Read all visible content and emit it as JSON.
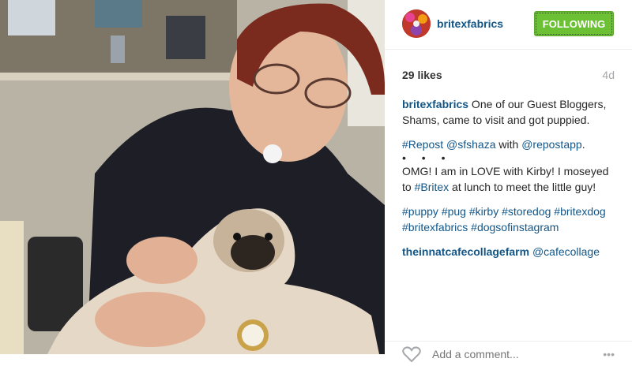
{
  "post": {
    "username": "britexfabrics",
    "follow_label": "FOLLOWING",
    "likes": "29 likes",
    "age": "4d",
    "caption": {
      "author": "britexfabrics",
      "line1": " One of our Guest Bloggers, Shams, came to visit and got puppied.",
      "repost_tag": "#Repost",
      "repost_user": "@sfshaza",
      "repost_with": " with ",
      "repost_app": "@repostapp",
      "repost_end": ".",
      "dots": "• • •",
      "body_text": "OMG! I am in LOVE with Kirby! I moseyed to ",
      "body_tag": "#Britex",
      "body_end": " at lunch to meet the little guy!",
      "hashtags": [
        "#puppy",
        "#pug",
        "#kirby",
        "#storedog",
        "#britexdog",
        "#britexfabrics",
        "#dogsofinstagram"
      ]
    },
    "comment": {
      "user": "theinnatcafecollagefarm",
      "text": "@cafecollage"
    },
    "footer": {
      "placeholder": "Add a comment...",
      "more": "•••"
    }
  },
  "colors": {
    "link": "#125688",
    "follow_green": "#6bc033",
    "muted": "#a5a7aa"
  },
  "icons": {
    "like": "heart-outline-icon"
  }
}
